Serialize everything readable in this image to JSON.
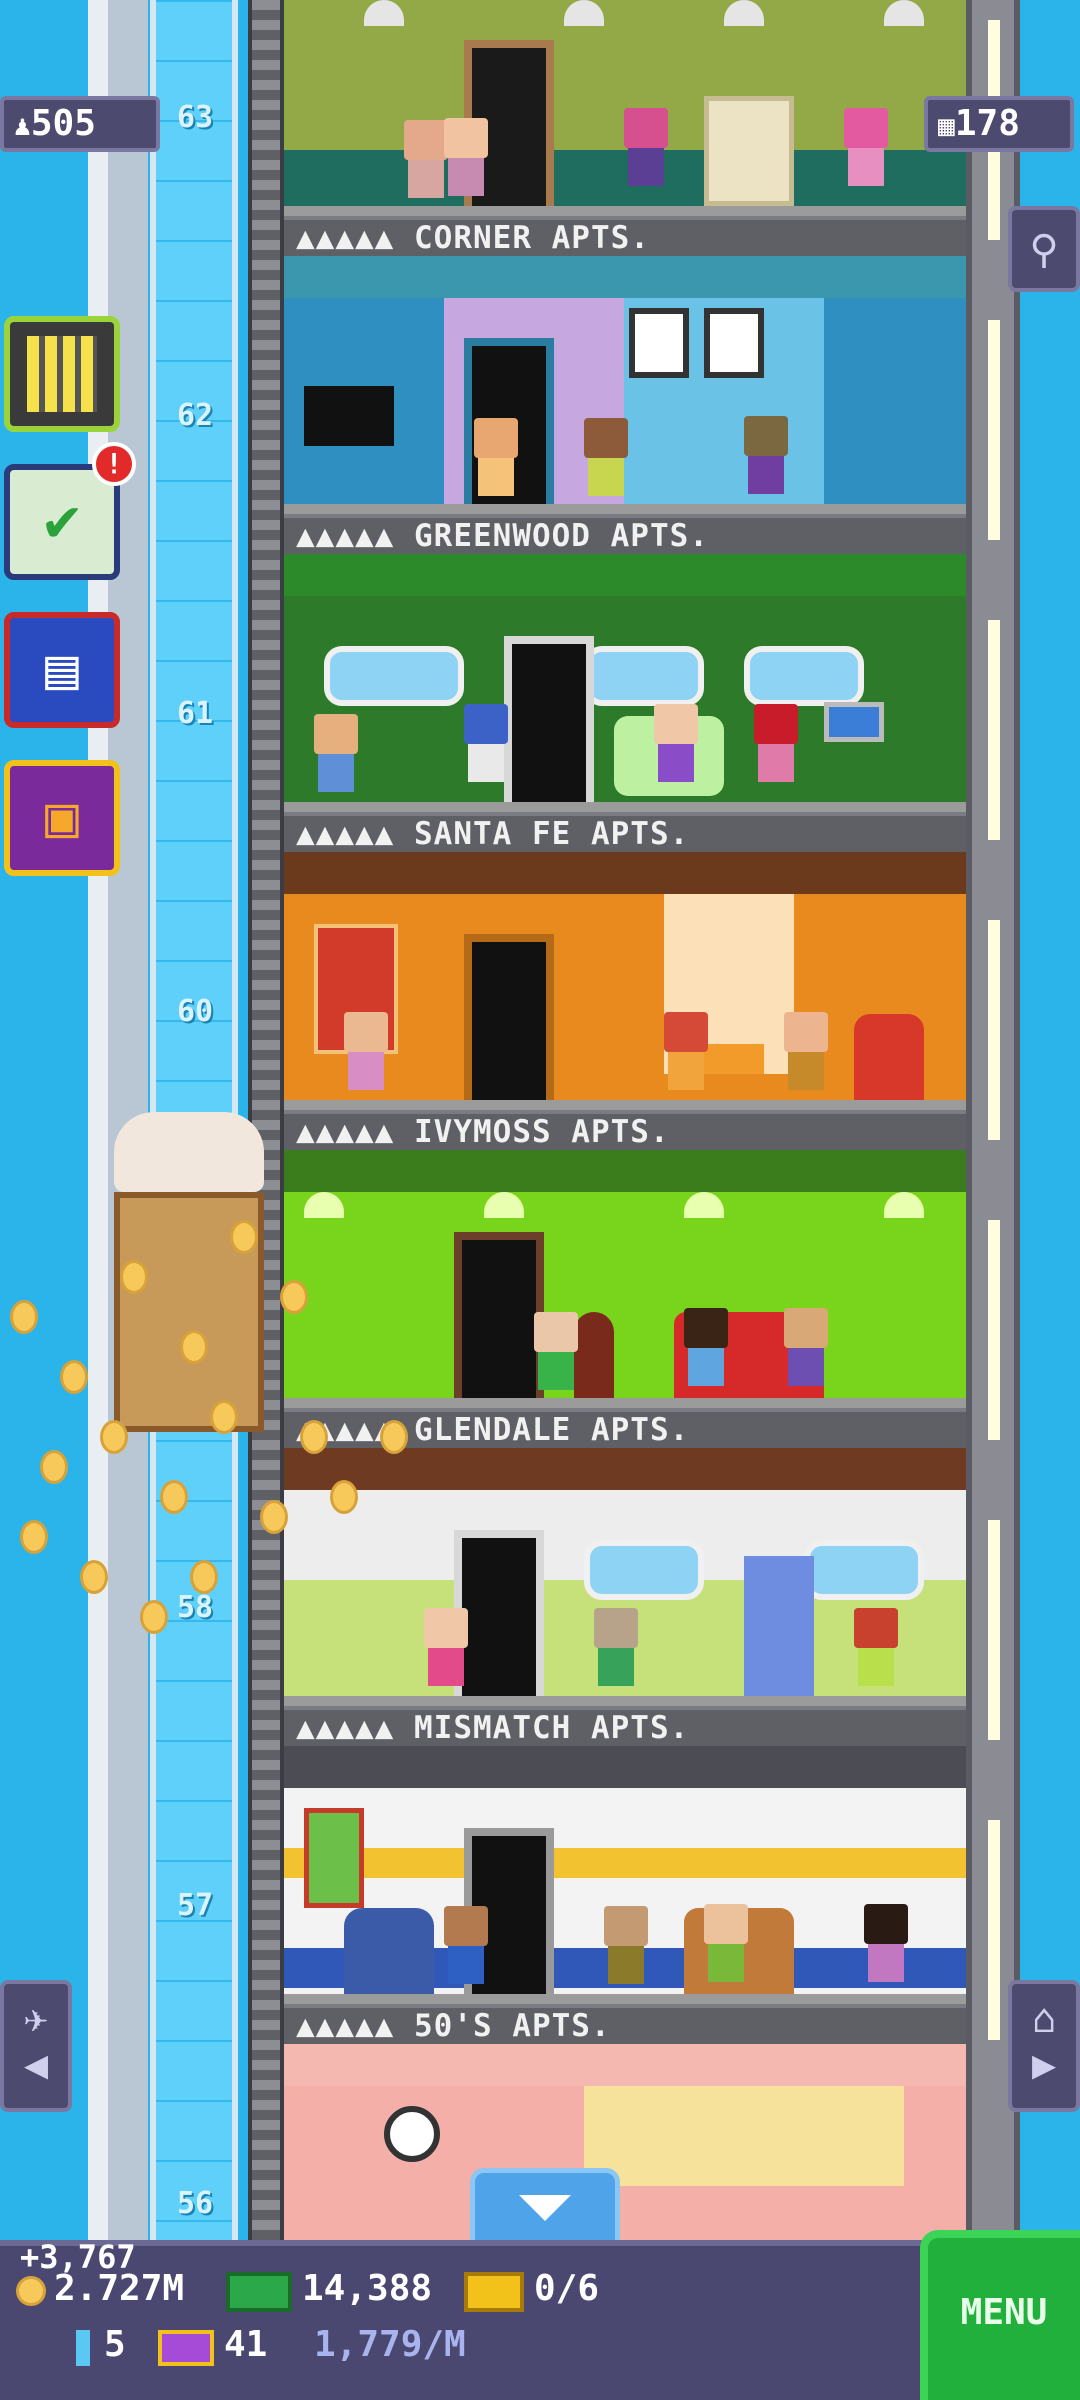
{
  "header": {
    "population": "505",
    "floors_count": "178"
  },
  "ruler": {
    "numbers": [
      "63",
      "62",
      "61",
      "60",
      "58",
      "57",
      "56"
    ]
  },
  "floors": [
    {
      "name": "CORNER APTS.",
      "stars": "▲▲▲▲▲"
    },
    {
      "name": "GREENWOOD APTS.",
      "stars": "▲▲▲▲▲"
    },
    {
      "name": "SANTA FE APTS.",
      "stars": "▲▲▲▲▲"
    },
    {
      "name": "IVYMOSS APTS.",
      "stars": "▲▲▲▲▲"
    },
    {
      "name": "GLENDALE APTS.",
      "stars": "▲▲▲▲▲"
    },
    {
      "name": "MISMATCH APTS.",
      "stars": "▲▲▲▲▲"
    },
    {
      "name": "50'S APTS.",
      "stars": "▲▲▲▲▲"
    }
  ],
  "side": {
    "buttons": [
      "build-menu",
      "missions",
      "calendar",
      "gift"
    ],
    "missions_badge": "!"
  },
  "bottom": {
    "coin_gain": "+3,767",
    "coins": "2.727M",
    "bux": "14,388",
    "vip": "0/6",
    "keys": "5",
    "golden_tickets": "41",
    "rate": "1,779/M",
    "menu_label": "MENU"
  }
}
